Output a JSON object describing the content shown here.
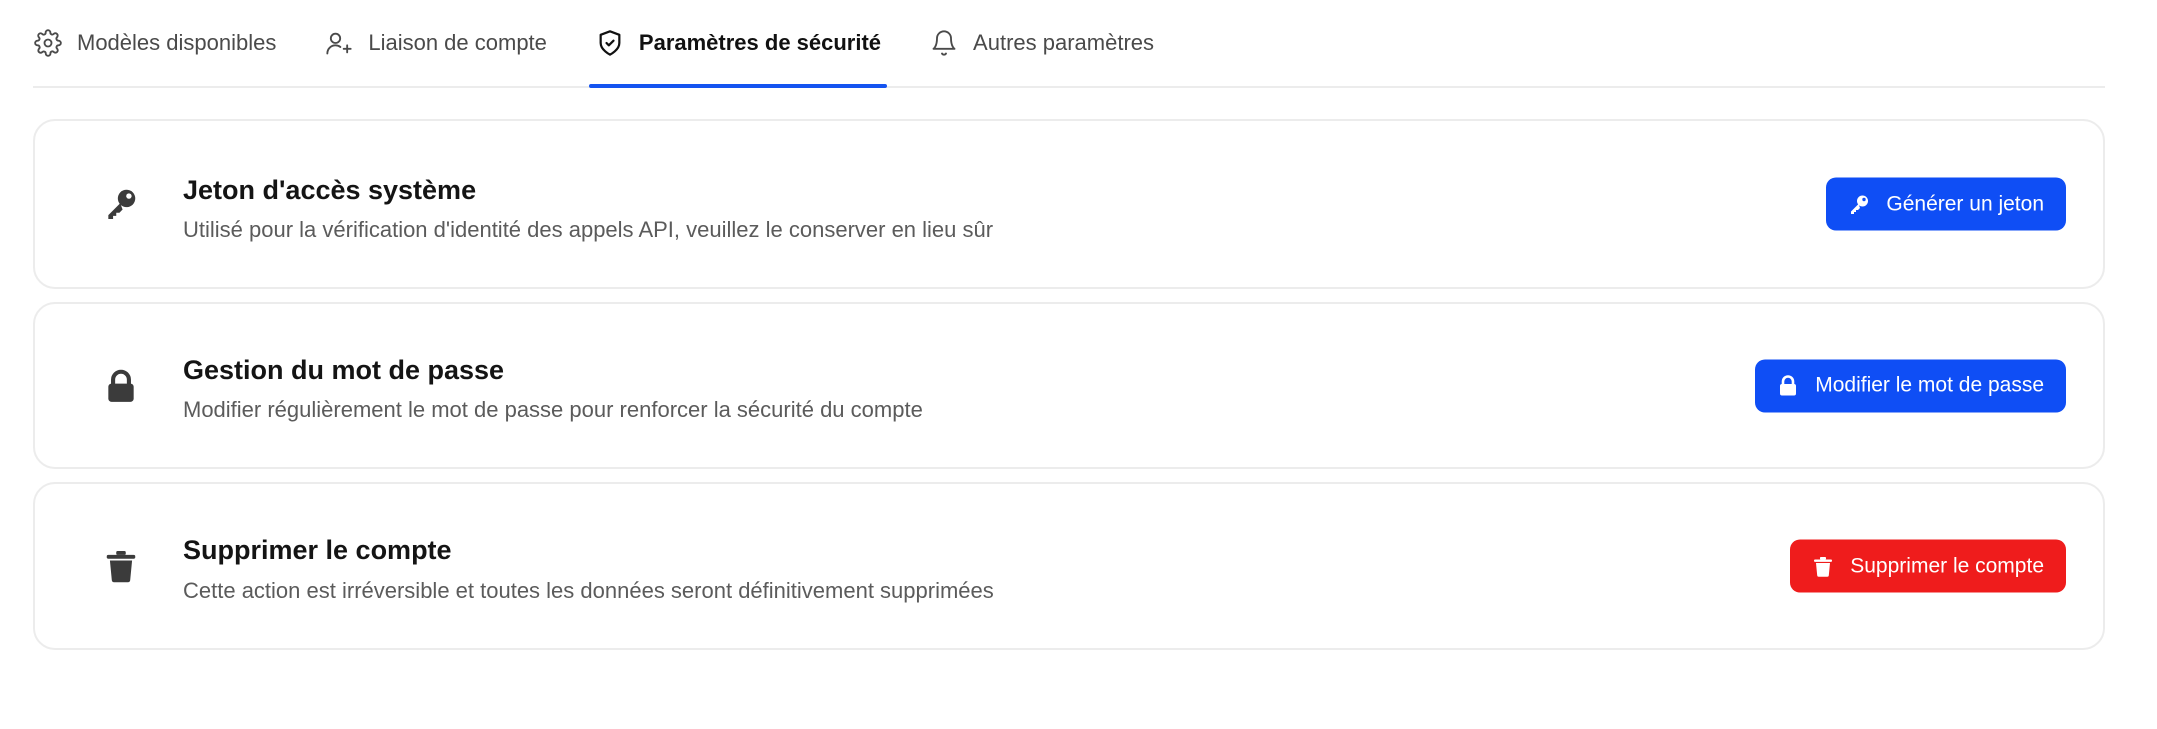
{
  "tabs": [
    {
      "label": "Modèles disponibles",
      "icon": "gear-icon",
      "active": false
    },
    {
      "label": "Liaison de compte",
      "icon": "user-plus-icon",
      "active": false
    },
    {
      "label": "Paramètres de sécurité",
      "icon": "shield-check-icon",
      "active": true
    },
    {
      "label": "Autres paramètres",
      "icon": "bell-icon",
      "active": false
    }
  ],
  "cards": [
    {
      "icon": "key-icon",
      "title": "Jeton d'accès système",
      "description": "Utilisé pour la vérification d'identité des appels API, veuillez le conserver en lieu sûr",
      "button": {
        "label": "Générer un jeton",
        "icon": "key-icon",
        "color": "#0f4ef5"
      }
    },
    {
      "icon": "lock-icon",
      "title": "Gestion du mot de passe",
      "description": "Modifier régulièrement le mot de passe pour renforcer la sécurité du compte",
      "button": {
        "label": "Modifier le mot de passe",
        "icon": "lock-icon",
        "color": "#0f4ef5"
      }
    },
    {
      "icon": "trash-icon",
      "title": "Supprimer le compte",
      "description": "Cette action est irréversible et toutes les données seront définitivement supprimées",
      "button": {
        "label": "Supprimer le compte",
        "icon": "trash-icon",
        "color": "#ef1c1c"
      }
    }
  ],
  "colors": {
    "accent": "#1554f0",
    "primary_button": "#0f4ef5",
    "danger_button": "#ef1c1c"
  }
}
